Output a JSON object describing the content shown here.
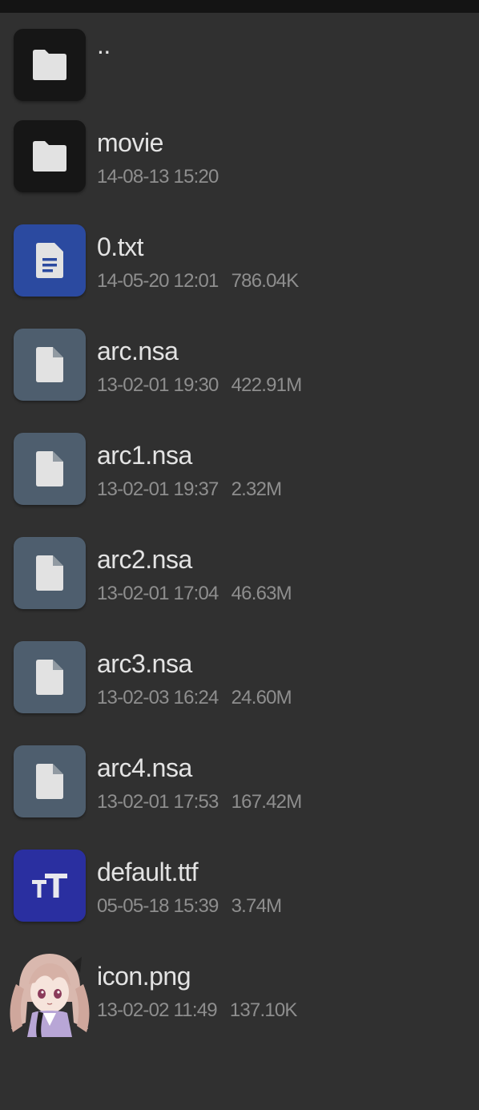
{
  "files": [
    {
      "type": "folder",
      "name": "..",
      "date": "",
      "size": "",
      "icon": "folder-icon"
    },
    {
      "type": "folder",
      "name": "movie",
      "date": "14-08-13 15:20",
      "size": "",
      "icon": "folder-icon"
    },
    {
      "type": "text",
      "name": "0.txt",
      "date": "14-05-20 12:01",
      "size": "786.04K",
      "icon": "text-file-icon"
    },
    {
      "type": "file",
      "name": "arc.nsa",
      "date": "13-02-01 19:30",
      "size": "422.91M",
      "icon": "file-icon"
    },
    {
      "type": "file",
      "name": "arc1.nsa",
      "date": "13-02-01 19:37",
      "size": "2.32M",
      "icon": "file-icon"
    },
    {
      "type": "file",
      "name": "arc2.nsa",
      "date": "13-02-01 17:04",
      "size": "46.63M",
      "icon": "file-icon"
    },
    {
      "type": "file",
      "name": "arc3.nsa",
      "date": "13-02-03 16:24",
      "size": "24.60M",
      "icon": "file-icon"
    },
    {
      "type": "file",
      "name": "arc4.nsa",
      "date": "13-02-01 17:53",
      "size": "167.42M",
      "icon": "file-icon"
    },
    {
      "type": "font",
      "name": "default.ttf",
      "date": "05-05-18 15:39",
      "size": "3.74M",
      "icon": "font-file-icon"
    },
    {
      "type": "image",
      "name": "icon.png",
      "date": "13-02-02 11:49",
      "size": "137.10K",
      "icon": "image-thumbnail"
    }
  ],
  "colors": {
    "background": "#303030",
    "folder_tile": "#161616",
    "text_tile": "#2b4aa0",
    "file_tile": "#4e5e6e",
    "font_tile": "#2a2fa0"
  }
}
